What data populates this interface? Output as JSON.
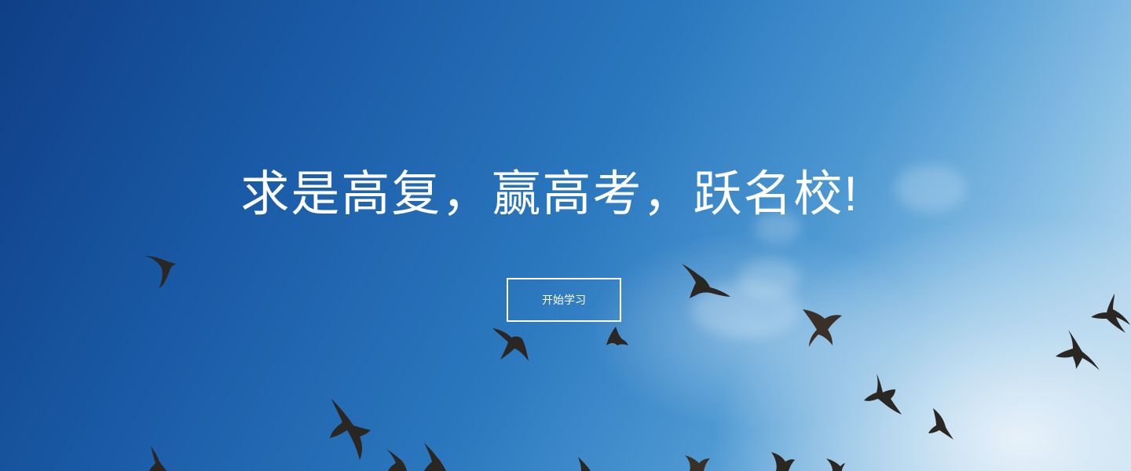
{
  "hero": {
    "headline": "求是高复，赢高考，跃名校!",
    "cta_label": "开始学习"
  },
  "colors": {
    "sky_dark": "#0f3f86",
    "sky_mid": "#2b78bf",
    "sky_light": "#cfe4f3",
    "bird": "#2a2622",
    "text": "#ffffff"
  }
}
